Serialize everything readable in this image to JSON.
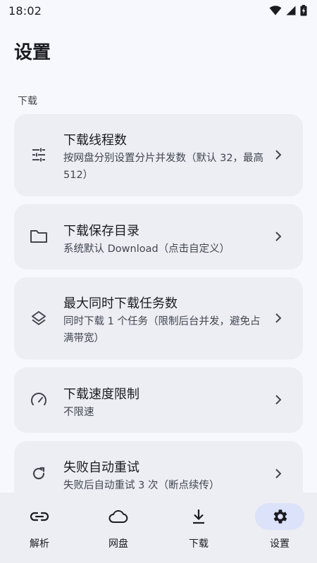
{
  "status_bar": {
    "time": "18:02",
    "icons": [
      "wifi-icon",
      "signal-icon",
      "battery-charging-icon"
    ]
  },
  "page": {
    "title": "设置"
  },
  "section": {
    "header": "下载"
  },
  "settings": [
    {
      "icon": "tune-sliders-icon",
      "title": "下载线程数",
      "subtitle": "按网盘分别设置分片并发数（默认 32，最高 512）"
    },
    {
      "icon": "folder-icon",
      "title": "下载保存目录",
      "subtitle": "系统默认 Download（点击自定义）"
    },
    {
      "icon": "layers-icon",
      "title": "最大同时下载任务数",
      "subtitle": "同时下载 1 个任务（限制后台并发，避免占满带宽）"
    },
    {
      "icon": "speedometer-icon",
      "title": "下载速度限制",
      "subtitle": "不限速"
    },
    {
      "icon": "refresh-icon",
      "title": "失败自动重试",
      "subtitle": "失败后自动重试 3 次（断点续传）"
    }
  ],
  "bottom_nav": {
    "items": [
      {
        "icon": "link-icon",
        "label": "解析"
      },
      {
        "icon": "cloud-icon",
        "label": "网盘"
      },
      {
        "icon": "download-icon",
        "label": "下载"
      },
      {
        "icon": "gear-icon",
        "label": "设置",
        "active": true
      }
    ]
  },
  "colors": {
    "background": "#f7f8fd",
    "card": "#eceef4",
    "nav_active_pill": "#dbe2f9",
    "text_primary": "#1b1b21",
    "text_secondary": "#44464f"
  }
}
